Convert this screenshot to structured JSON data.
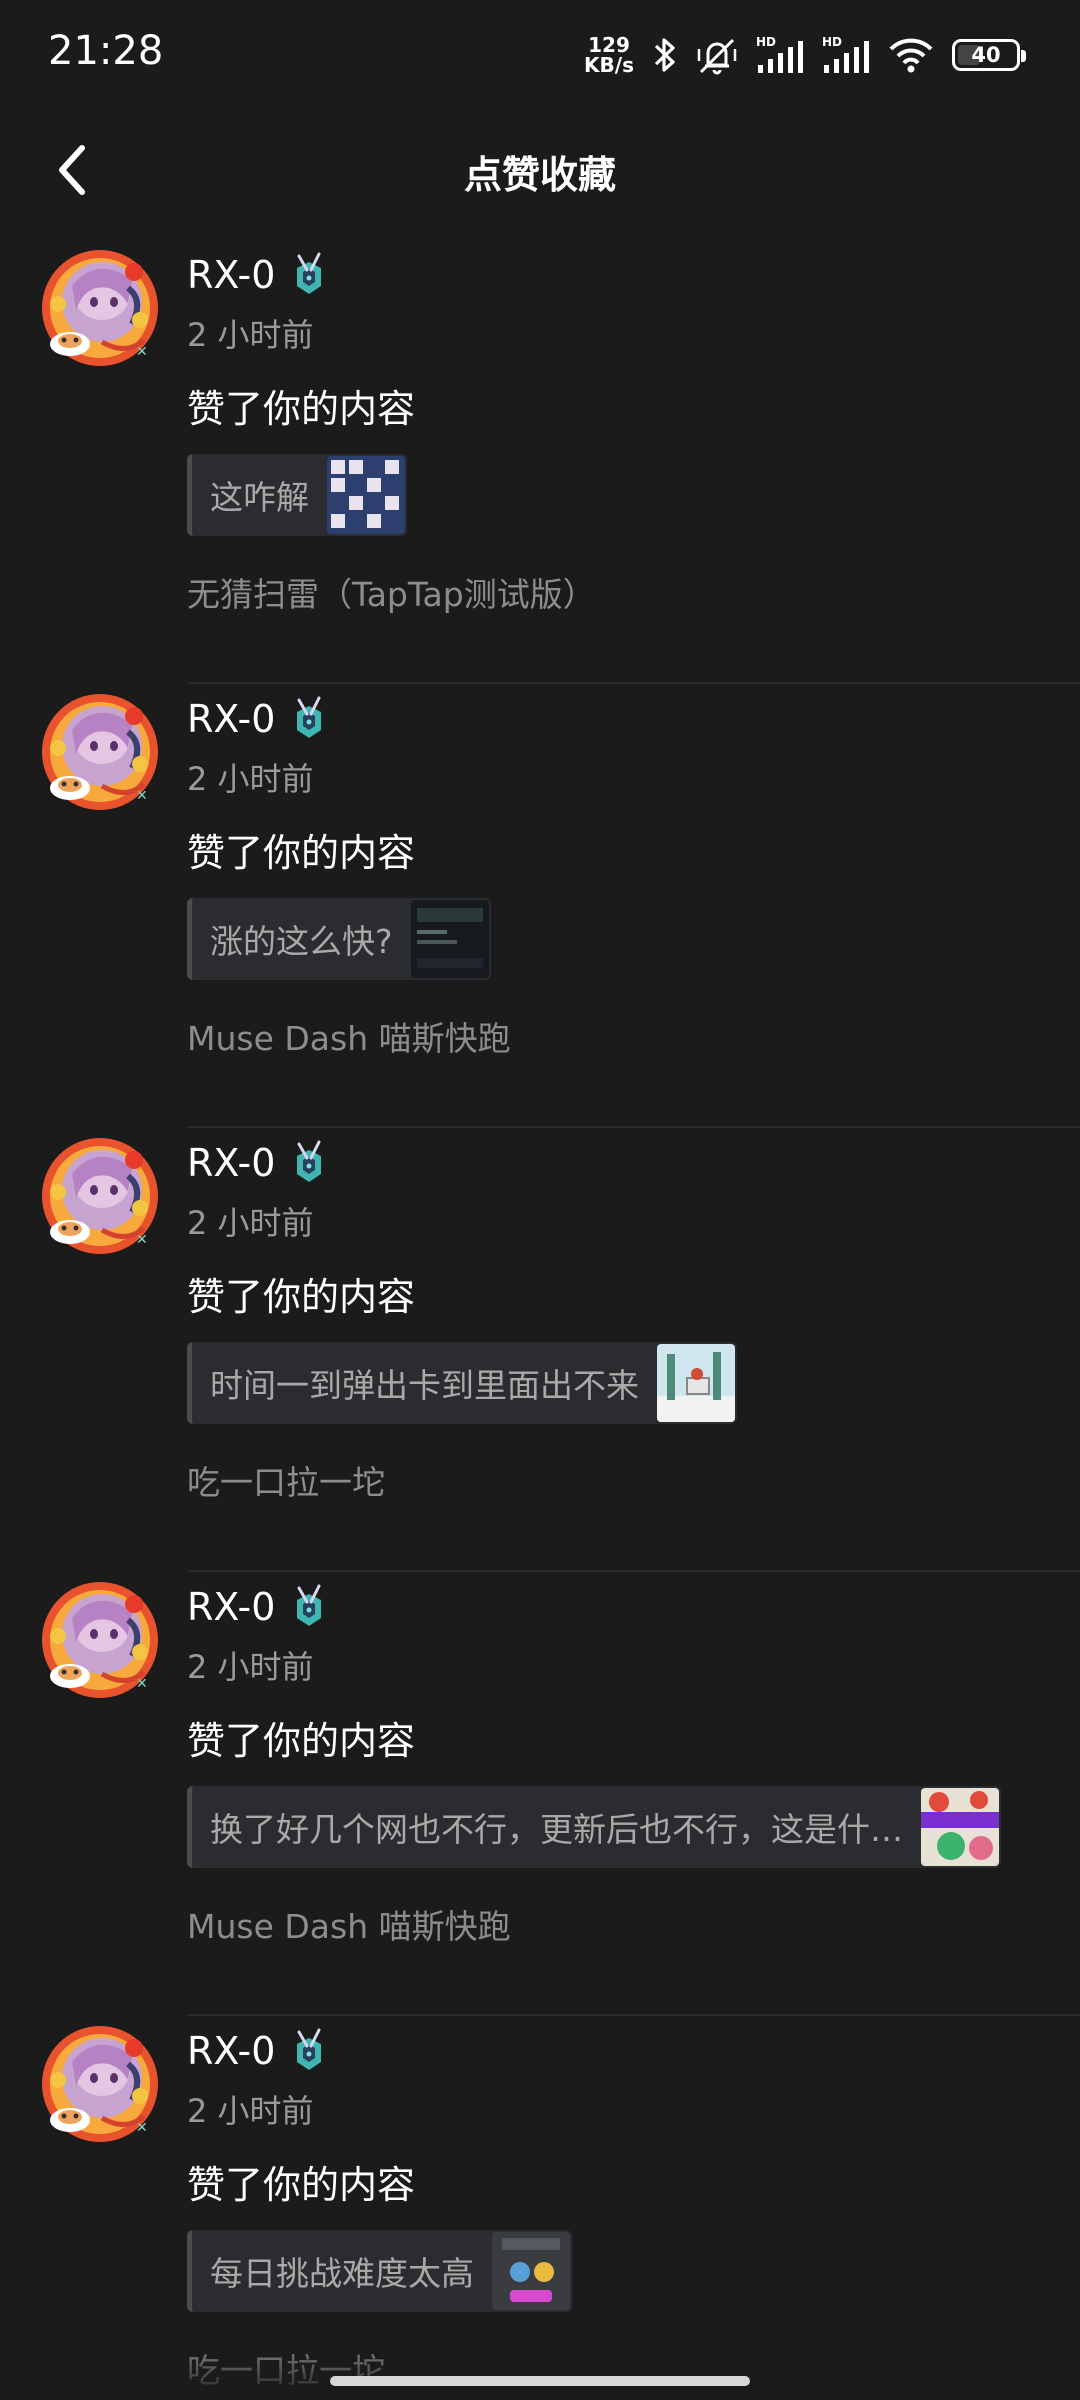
{
  "status_bar": {
    "time": "21:28",
    "net_speed_value": "129",
    "net_speed_unit": "KB/s",
    "battery": "40",
    "battery_level": 0.4,
    "icons": [
      "bluetooth-icon",
      "mute-vibrate-icon",
      "hd-signal-icon",
      "hd-signal-icon",
      "wifi-icon",
      "battery-icon"
    ]
  },
  "header": {
    "title": "点赞收藏",
    "back_icon": "chevron-left-icon"
  },
  "feed": {
    "items": [
      {
        "username": "RX-0",
        "time": "2 小时前",
        "action": "赞了你的内容",
        "quote": "这咋解",
        "game": "无猜扫雷（TapTap测试版）"
      },
      {
        "username": "RX-0",
        "time": "2 小时前",
        "action": "赞了你的内容",
        "quote": "涨的这么快?",
        "game": "Muse Dash 喵斯快跑"
      },
      {
        "username": "RX-0",
        "time": "2 小时前",
        "action": "赞了你的内容",
        "quote": "时间一到弹出卡到里面出不来",
        "game": "吃一口拉一坨"
      },
      {
        "username": "RX-0",
        "time": "2 小时前",
        "action": "赞了你的内容",
        "quote": "换了好几个网也不行，更新后也不行，这是什…",
        "game": "Muse Dash 喵斯快跑"
      },
      {
        "username": "RX-0",
        "time": "2 小时前",
        "action": "赞了你的内容",
        "quote": "每日挑战难度太高",
        "game": "吃一口拉一坨"
      }
    ]
  },
  "colors": {
    "background": "#1b1b1b",
    "quote_background": "#2b2c30",
    "secondary_text": "#9a9a9a"
  }
}
